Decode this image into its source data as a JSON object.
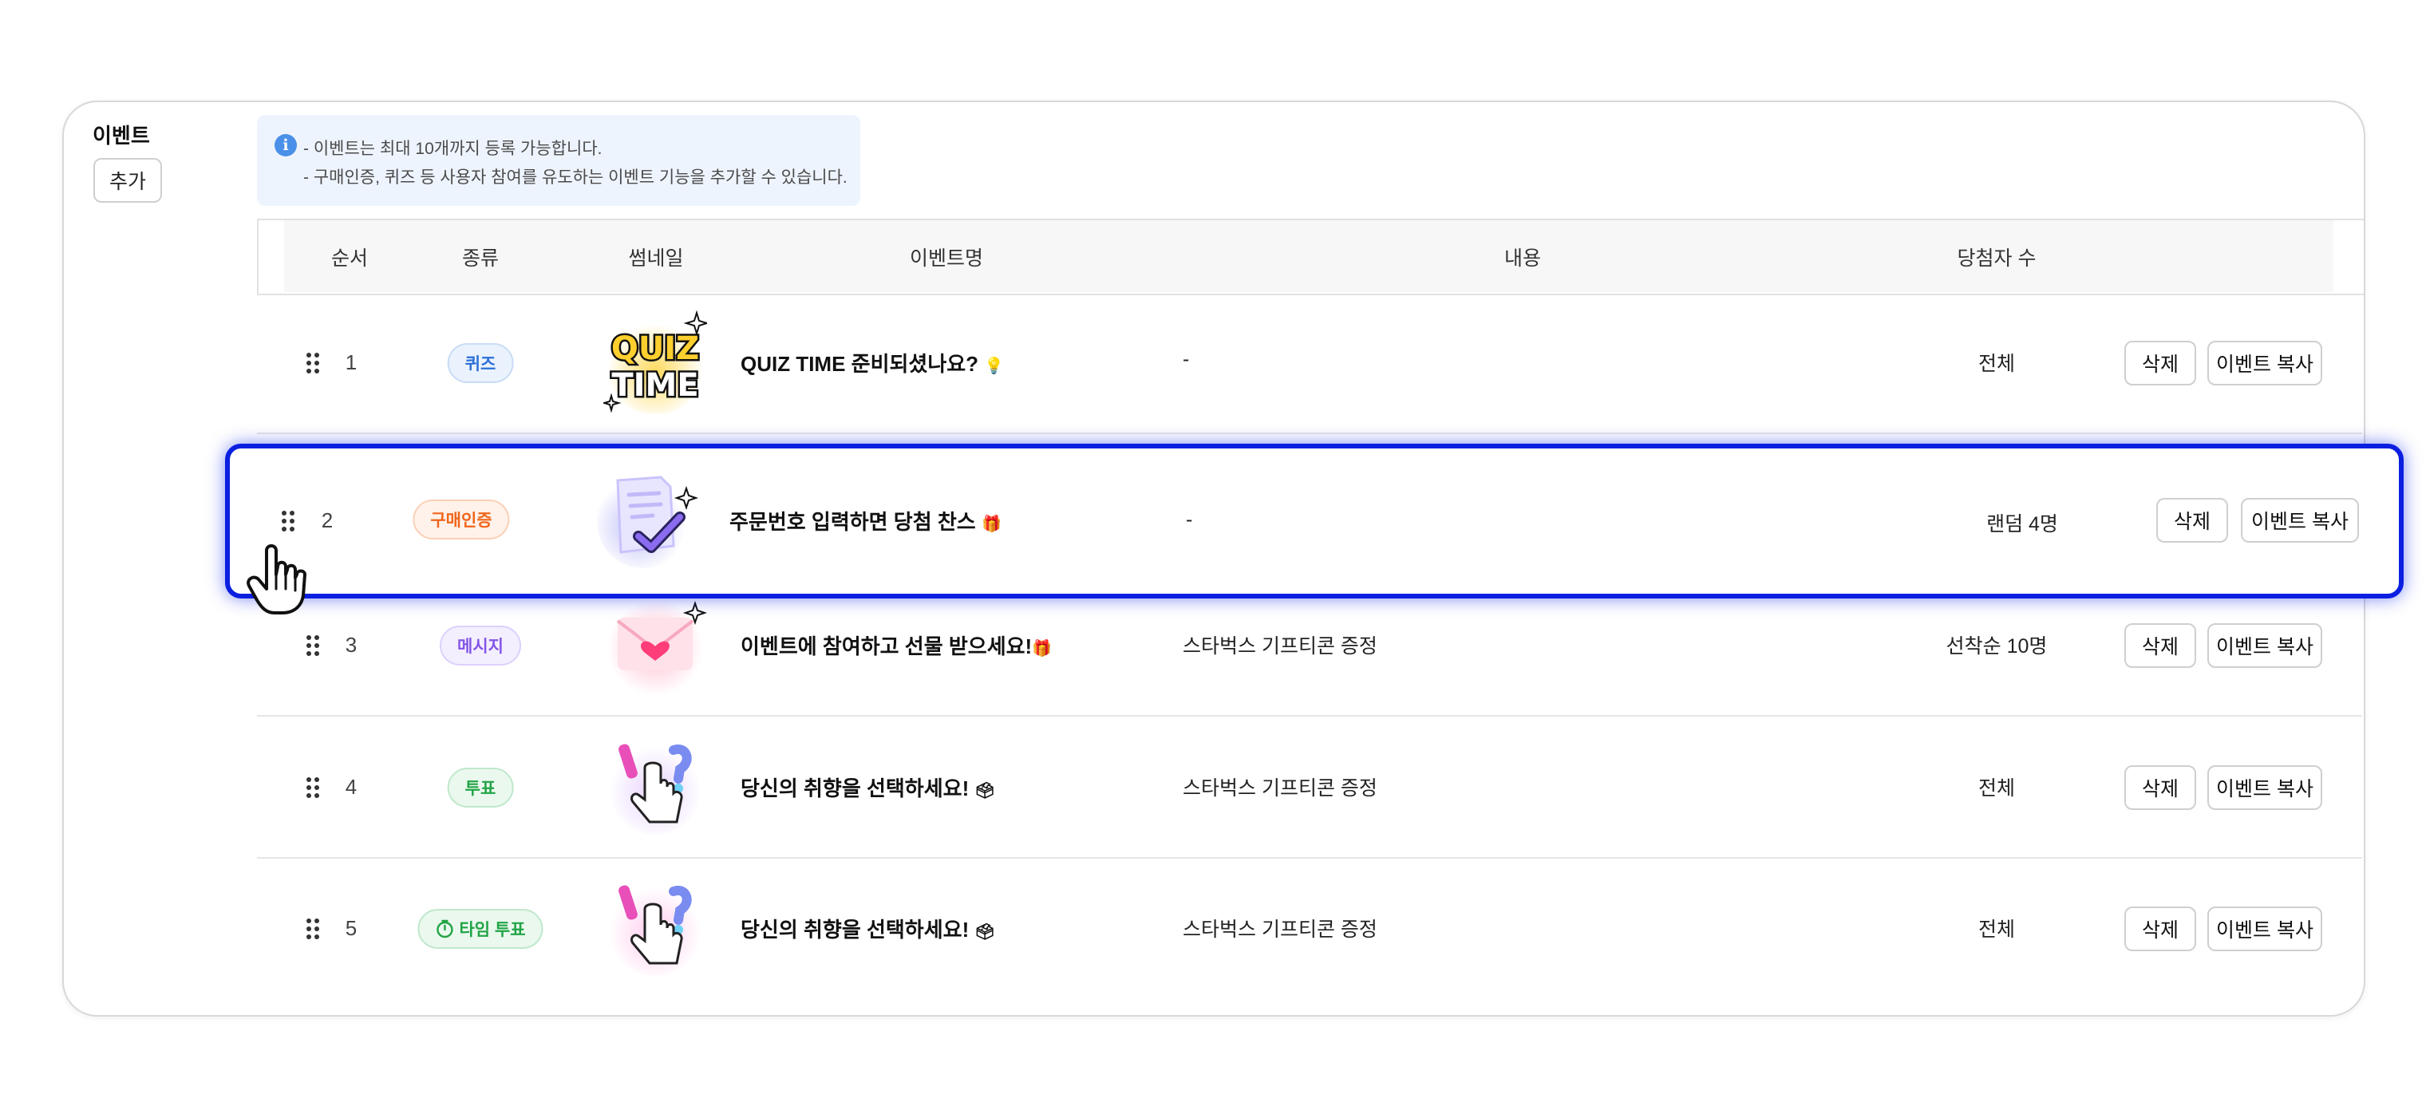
{
  "section": {
    "title": "이벤트",
    "add_label": "추가"
  },
  "info": {
    "line1": "- 이벤트는 최대 10개까지 등록 가능합니다.",
    "line2": "- 구매인증, 퀴즈 등 사용자 참여를 유도하는 이벤트 기능을 추가할 수 있습니다."
  },
  "table": {
    "headers": [
      "순서",
      "종류",
      "썸네일",
      "이벤트명",
      "내용",
      "당첨자 수"
    ],
    "rows": [
      {
        "order": "1",
        "type": "퀴즈",
        "title": "QUIZ TIME 준비되셨나요?",
        "title_emoji": "💡",
        "content": "-",
        "winners": "전체",
        "thumb_icon": "quiz-time-icon",
        "thumb_text1": "QUIZ",
        "thumb_text2": "TIME"
      },
      {
        "order": "2",
        "type": "구매인증",
        "title": "주문번호 입력하면 당첨 찬스",
        "title_emoji": "🎁",
        "content": "-",
        "winners": "랜덤 4명",
        "thumb_icon": "document-check-icon"
      },
      {
        "order": "3",
        "type": "메시지",
        "title": "이벤트에 참여하고 선물 받으세요!",
        "title_emoji": "🎁",
        "content": "스타벅스 기프티콘 증정",
        "winners": "선착순 10명",
        "thumb_icon": "heart-envelope-icon"
      },
      {
        "order": "4",
        "type": "투표",
        "title": "당신의 취향을 선택하세요!",
        "title_emoji": "🗳",
        "content": "스타벅스 기프티콘 증정",
        "winners": "전체",
        "thumb_icon": "hand-vote-icon"
      },
      {
        "order": "5",
        "type": "타임 투표",
        "title": "당신의 취향을 선택하세요!",
        "title_emoji": "🗳",
        "content": "스타벅스 기프티콘 증정",
        "winners": "전체",
        "thumb_icon": "hand-vote-icon"
      }
    ],
    "delete_label": "삭제",
    "copy_label": "이벤트 복사"
  },
  "colors": {
    "highlight": "#0a1fe0",
    "info_bg": "#eef4fd",
    "quiz": "#2c6fd6",
    "purchase": "#f0661b",
    "message": "#8356e6",
    "vote": "#22a446"
  }
}
